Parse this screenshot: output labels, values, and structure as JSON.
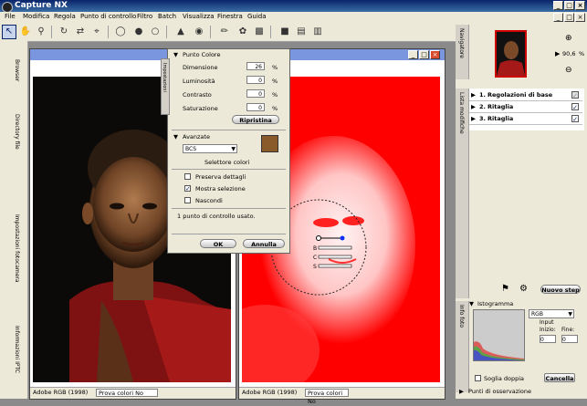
{
  "app": {
    "title": "Capture NX"
  },
  "menu": [
    "File",
    "Modifica",
    "Regola",
    "Punto di controllo",
    "Filtro",
    "Batch",
    "Visualizza",
    "Finestra",
    "Guida"
  ],
  "window_controls": {
    "minimize": "_",
    "maximize": "□",
    "close": "×"
  },
  "left_tabs": {
    "browser": "Browser",
    "directory": "Directory file",
    "metadata": "Impostazioni fotocamera",
    "iptc": "Informazioni IPTC"
  },
  "image_left": {
    "status": {
      "profile": "Adobe RGB (1998)",
      "proof": "Prova colori No"
    }
  },
  "image_right": {
    "status": {
      "profile": "Adobe RGB (1998)",
      "proof": "Prova colori No"
    },
    "point_labels": [
      "B",
      "C",
      "S"
    ]
  },
  "dialog": {
    "side_tab": "Impostazioni",
    "section_title": "Punto Colore",
    "fields": [
      {
        "label": "Dimensione",
        "value": "26",
        "unit": "%"
      },
      {
        "label": "Luminosità",
        "value": "0",
        "unit": "%"
      },
      {
        "label": "Contrasto",
        "value": "0",
        "unit": "%"
      },
      {
        "label": "Saturazione",
        "value": "0",
        "unit": "%"
      }
    ],
    "reset_label": "Ripristina",
    "advanced_title": "Avanzate",
    "mode_value": "BCS",
    "color_picker_label": "Selettore colori",
    "picker_color": "#8b5a2b",
    "checkboxes": [
      {
        "label": "Preserva dettagli",
        "checked": false
      },
      {
        "label": "Mostra selezione",
        "checked": true
      },
      {
        "label": "Nascondi",
        "checked": false
      }
    ],
    "status": "1 punto di controllo usato.",
    "ok_label": "OK",
    "cancel_label": "Annulla"
  },
  "right_panel": {
    "navigator_tab": "Navigatore",
    "zoom_value": "90,6",
    "zoom_unit": "%",
    "edit_list_tab": "Lista modifiche",
    "edit_list": [
      {
        "num": "1.",
        "label": "Regolazioni di base",
        "checked": true
      },
      {
        "num": "2.",
        "label": "Ritaglia",
        "checked": true
      },
      {
        "num": "3.",
        "label": "Ritaglia",
        "checked": true
      }
    ],
    "new_step_label": "Nuovo step",
    "photo_info_tab": "Info foto",
    "histogram_title": "Istogramma",
    "channel": "RGB",
    "input_label": "Input",
    "start_label": "Inizio:",
    "end_label": "Fine:",
    "start_value": "0",
    "end_value": "0",
    "double_threshold_label": "Soglia doppia",
    "cancel_label": "Cancella",
    "watch_points_label": "Punti di osservazione"
  },
  "colors": {
    "red_overlay": "#ff0000",
    "title_blue": "#0a246a",
    "robe_red": "#8b1010"
  }
}
